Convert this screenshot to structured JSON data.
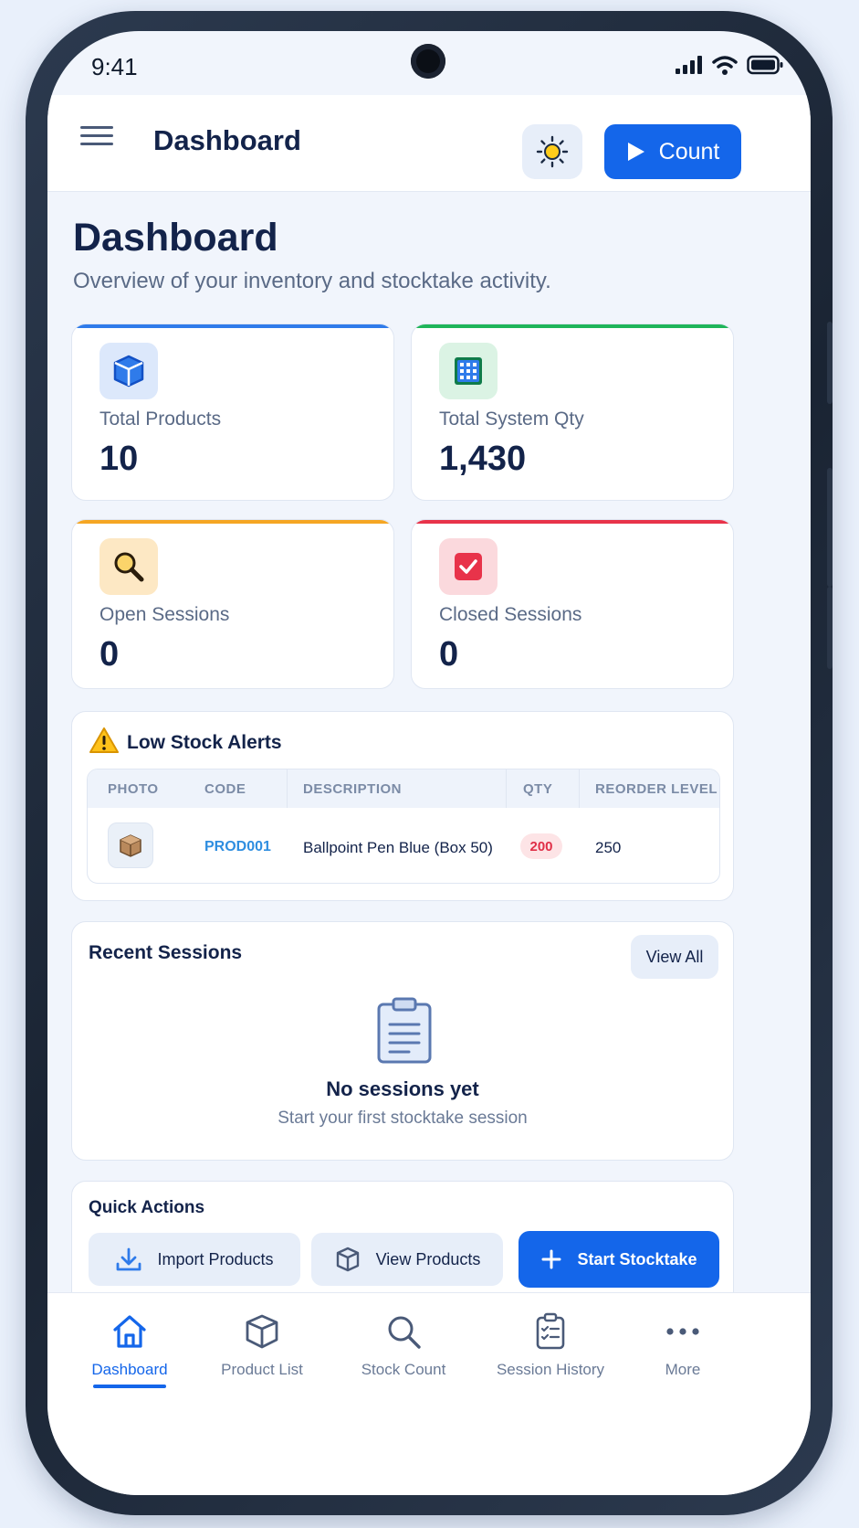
{
  "status_bar": {
    "time": "9:41"
  },
  "header": {
    "title": "Dashboard",
    "count_label": "Count"
  },
  "page": {
    "title": "Dashboard",
    "subtitle": "Overview of your inventory and stocktake activity."
  },
  "stats": [
    {
      "label": "Total Products",
      "value": "10",
      "accent": "#2f7bea",
      "icon": "cube-icon"
    },
    {
      "label": "Total System Qty",
      "value": "1,430",
      "accent": "#1fb55a",
      "icon": "grid-icon"
    },
    {
      "label": "Open Sessions",
      "value": "0",
      "accent": "#f5a623",
      "icon": "magnifier-icon"
    },
    {
      "label": "Closed Sessions",
      "value": "0",
      "accent": "#e8334a",
      "icon": "check-box-icon"
    }
  ],
  "low_stock": {
    "title": "Low Stock Alerts",
    "columns": [
      "PHOTO",
      "CODE",
      "DESCRIPTION",
      "QTY",
      "REORDER LEVEL"
    ],
    "rows": [
      {
        "code": "PROD001",
        "description": "Ballpoint Pen Blue (Box 50)",
        "qty": "200",
        "reorder_level": "250"
      }
    ]
  },
  "recent_sessions": {
    "title": "Recent Sessions",
    "view_all": "View All",
    "empty_title": "No sessions yet",
    "empty_sub": "Start your first stocktake session"
  },
  "quick_actions": {
    "title": "Quick Actions",
    "import": "Import Products",
    "view": "View Products",
    "start": "Start Stocktake"
  },
  "nav": [
    {
      "label": "Dashboard",
      "icon": "home-icon",
      "active": true
    },
    {
      "label": "Product List",
      "icon": "box-icon"
    },
    {
      "label": "Stock Count",
      "icon": "search-icon"
    },
    {
      "label": "Session History",
      "icon": "clipboard-list-icon"
    },
    {
      "label": "More",
      "icon": "more-dots-icon"
    }
  ],
  "colors": {
    "primary": "#1466ea",
    "danger": "#e02f47",
    "code_link": "#2f8ee0"
  }
}
